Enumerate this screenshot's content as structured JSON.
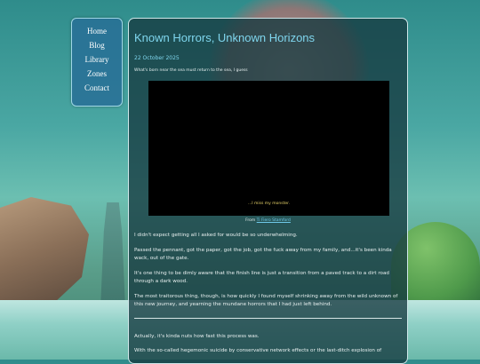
{
  "nav": {
    "items": [
      "Home",
      "Blog",
      "Library",
      "Zones",
      "Contact"
    ]
  },
  "post": {
    "title": "Known Horrors, Unknown Horizons",
    "date": "22 October 2025",
    "subtitle": "What's born near the sea must return to the sea, I guess",
    "video_caption": "...I miss my monster.",
    "credit_prefix": "From",
    "credit_link": "Ti Fiero Stamford",
    "paragraphs": [
      "I didn't expect getting all I asked for would be so underwhelming.",
      "Passed the pennant, got the paper, got the job, got the fuck away from my family, and...it's been kinda wack, out of the gate.",
      "It's one thing to be dimly aware that the finish line is just a transition from a paved track to a dirt road through a dark wood.",
      "The most traitorous thing, though, is how quickly I found myself shrinking away from the wild unknown of this new journey, and yearning the mundane horrors that I had just left behind."
    ],
    "after_rule": [
      "Actually, it's kinda nuts how fast this process was.",
      "With the so-called hegemonic suicide by conservative network effects or the last-ditch explosion of"
    ]
  },
  "colors": {
    "accent": "#7fd6ee",
    "nav_bg": "#286e96",
    "panel_bg": "#163a40"
  }
}
